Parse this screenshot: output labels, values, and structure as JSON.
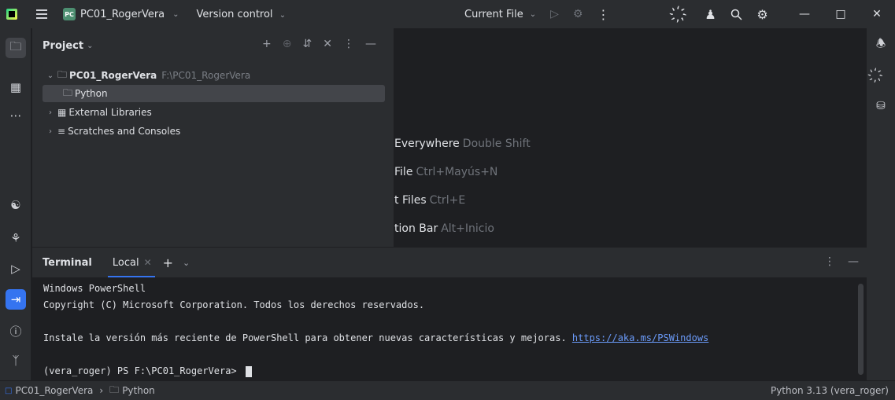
{
  "titlebar": {
    "project_badge": "PC",
    "project_name": "PC01_RogerVera",
    "vcs_menu": "Version control",
    "run_config": "Current File"
  },
  "project_panel": {
    "title": "Project",
    "tree": [
      {
        "label": "PC01_RogerVera",
        "hint": "F:\\PC01_RogerVera"
      },
      {
        "label": "Python"
      },
      {
        "label": "External Libraries"
      },
      {
        "label": "Scratches and Consoles"
      }
    ]
  },
  "editor_shortcuts": [
    {
      "name": "Everywhere",
      "prefix": "",
      "key": "Double Shift"
    },
    {
      "name": "File",
      "key": "Ctrl+Mayús+N"
    },
    {
      "name": "t Files",
      "key": "Ctrl+E"
    },
    {
      "name": "tion Bar",
      "key": "Alt+Inicio"
    }
  ],
  "terminal": {
    "title": "Terminal",
    "tab_label": "Local",
    "lines": [
      "Windows PowerShell",
      "Copyright (C) Microsoft Corporation. Todos los derechos reservados.",
      ""
    ],
    "install_text": "Instale la versión más reciente de PowerShell para obtener nuevas características y mejoras. ",
    "install_link": "https://aka.ms/PSWindows",
    "prompt": "(vera_roger) PS F:\\PC01_RogerVera> "
  },
  "statusbar": {
    "crumb_project": "PC01_RogerVera",
    "crumb_folder": "Python",
    "interpreter": "Python 3.13 (vera_roger)"
  },
  "colors": {
    "accent": "#3574f0",
    "background": "#1e1f22",
    "panel": "#2b2d30"
  }
}
